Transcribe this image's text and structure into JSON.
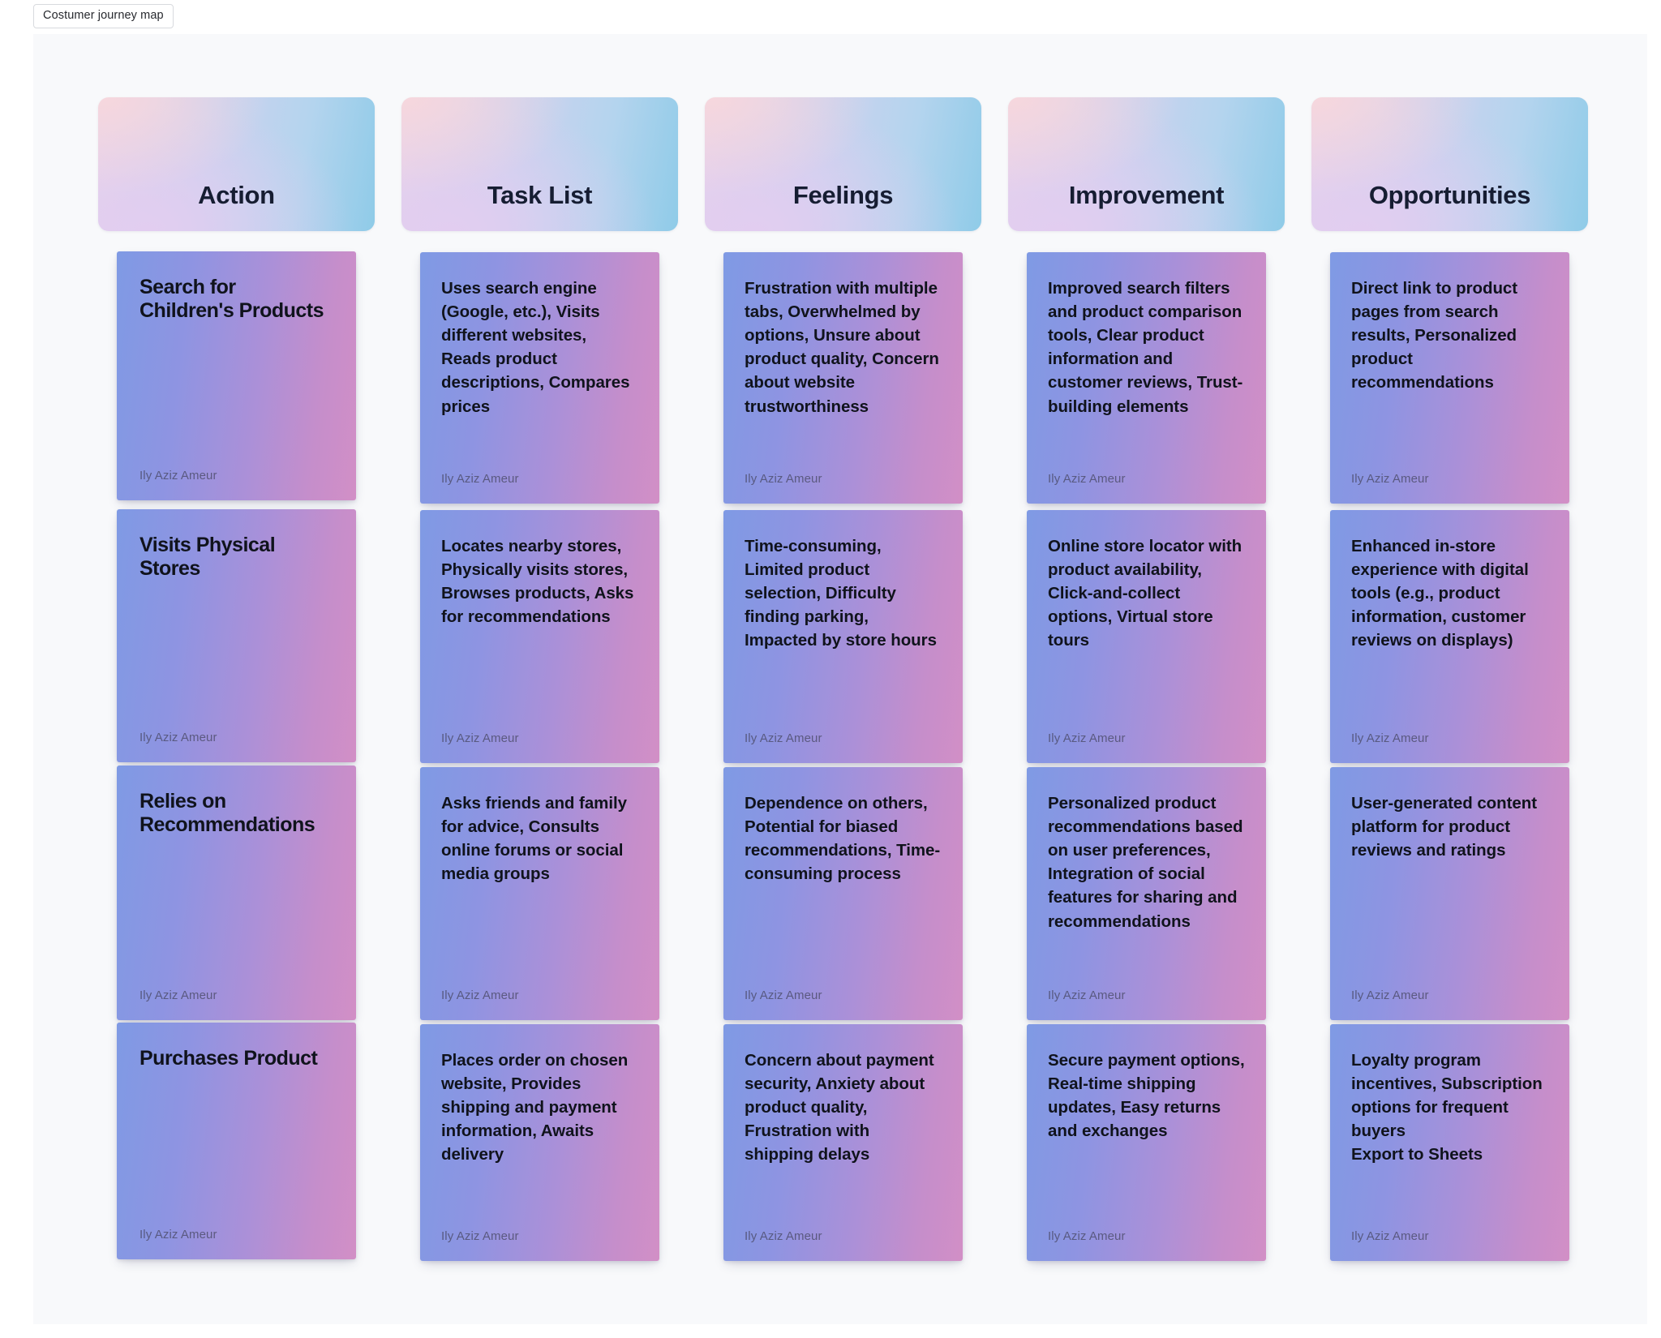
{
  "document": {
    "chip_label": "Costumer journey map"
  },
  "board": {
    "author": "Ily Aziz Ameur",
    "columns": [
      {
        "id": "action",
        "title": "Action"
      },
      {
        "id": "task-list",
        "title": "Task List"
      },
      {
        "id": "feelings",
        "title": "Feelings"
      },
      {
        "id": "improvement",
        "title": "Improvement"
      },
      {
        "id": "opportunities",
        "title": "Opportunities"
      }
    ],
    "rows": [
      {
        "action": "Search for Children's Products",
        "task_list": "Uses search engine (Google, etc.), Visits different websites, Reads product descriptions, Compares prices",
        "feelings": "Frustration with multiple tabs, Overwhelmed by options, Unsure about product quality, Concern about website trustworthiness",
        "improvement": "Improved search filters and product comparison tools, Clear product information and customer reviews, Trust-building elements",
        "opportunities": "Direct link to product pages from search results, Personalized product recommendations"
      },
      {
        "action": "Visits Physical Stores",
        "task_list": "Locates nearby stores, Physically visits stores, Browses products, Asks for recommendations",
        "feelings": "Time-consuming, Limited product selection, Difficulty finding parking, Impacted by store hours",
        "improvement": "Online store locator with product availability, Click-and-collect options, Virtual store tours",
        "opportunities": "Enhanced in-store experience with digital tools (e.g., product information, customer reviews on displays)"
      },
      {
        "action": "Relies on Recommendations",
        "task_list": "Asks friends and family for advice, Consults online forums or social media groups",
        "feelings": "Dependence on others, Potential for biased recommendations, Time-consuming process",
        "improvement": "Personalized product recommendations based on user preferences, Integration of social features for sharing and recommendations",
        "opportunities": "User-generated content platform for product reviews and ratings"
      },
      {
        "action": "Purchases Product",
        "task_list": "Places order on chosen website, Provides shipping and payment information, Awaits delivery",
        "feelings": "Concern about payment security, Anxiety about product quality, Frustration with shipping delays",
        "improvement": "Secure payment options, Real-time shipping updates, Easy returns and exchanges",
        "opportunities": "Loyalty program incentives, Subscription options for frequent buyers\nExport to Sheets"
      }
    ]
  },
  "theme": {
    "canvas_bg": "#f8f9fb",
    "header_gradient_from": "#e8d4ea",
    "header_gradient_to": "#8fcbe8",
    "note_gradient_from": "#7f9ae4",
    "note_gradient_to": "#d28fc6",
    "title_color": "#161d32",
    "note_text_color": "#10131c"
  }
}
